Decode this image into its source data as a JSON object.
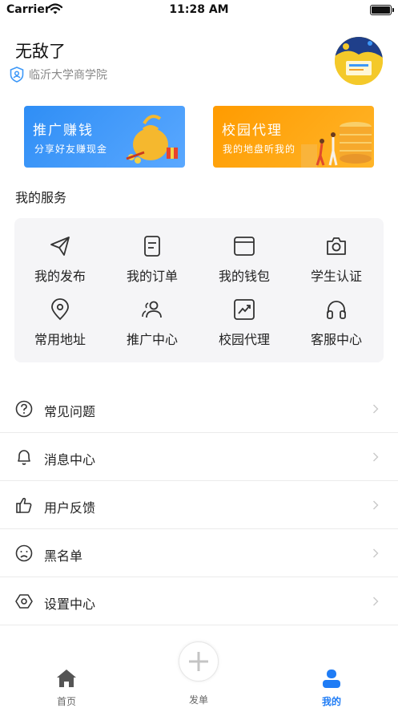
{
  "status_bar": {
    "carrier": "Carrier",
    "time": "11:28 AM"
  },
  "profile": {
    "name": "无敌了",
    "school": "临沂大学商学院"
  },
  "banners": [
    {
      "title": "推广赚钱",
      "subtitle": "分享好友赚现金",
      "color": "#3d98f8"
    },
    {
      "title": "校园代理",
      "subtitle": "我的地盘听我的",
      "color": "#ffa514"
    }
  ],
  "services": {
    "title": "我的服务",
    "items": [
      {
        "label": "我的发布",
        "icon": "paper-plane-icon"
      },
      {
        "label": "我的订单",
        "icon": "order-document-icon"
      },
      {
        "label": "我的钱包",
        "icon": "wallet-icon"
      },
      {
        "label": "学生认证",
        "icon": "camera-icon"
      },
      {
        "label": "常用地址",
        "icon": "location-pin-icon"
      },
      {
        "label": "推广中心",
        "icon": "users-icon"
      },
      {
        "label": "校园代理",
        "icon": "trend-chart-icon"
      },
      {
        "label": "客服中心",
        "icon": "headphones-icon"
      }
    ]
  },
  "menu": [
    {
      "label": "常见问题",
      "icon": "question-circle-icon"
    },
    {
      "label": "消息中心",
      "icon": "bell-icon"
    },
    {
      "label": "用户反馈",
      "icon": "thumbs-up-icon"
    },
    {
      "label": "黑名单",
      "icon": "sad-face-icon"
    },
    {
      "label": "设置中心",
      "icon": "settings-hexagon-icon"
    }
  ],
  "tab_bar": {
    "items": [
      {
        "label": "首页",
        "icon": "home-icon"
      },
      {
        "label": "发单",
        "icon": "plus-icon"
      },
      {
        "label": "我的",
        "icon": "user-icon",
        "active": true
      }
    ],
    "active_color": "#1f7cf5"
  }
}
